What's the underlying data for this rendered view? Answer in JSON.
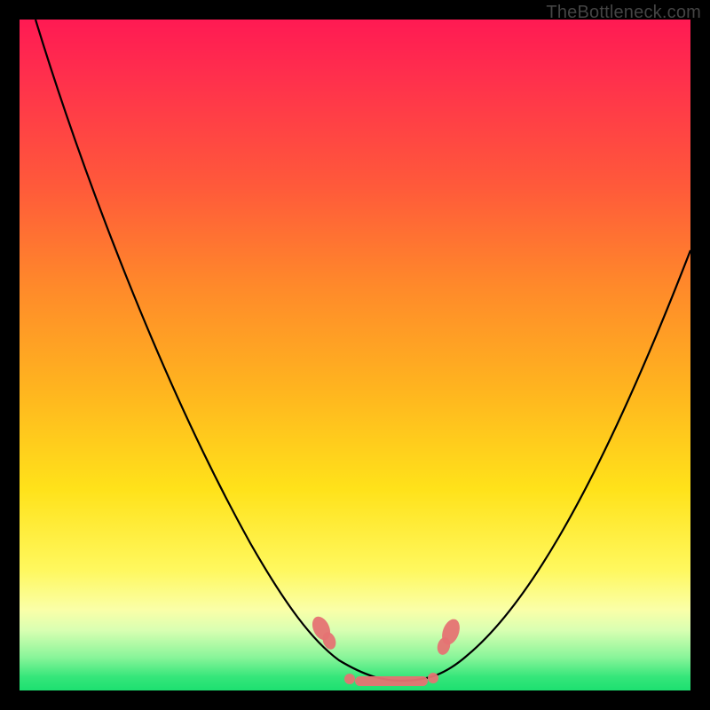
{
  "watermark": "TheBottleneck.com",
  "colors": {
    "background": "#000000",
    "gradient_top": "#ff1a53",
    "gradient_mid": "#ffe21a",
    "gradient_bottom": "#1de070",
    "curve": "#000000",
    "marker": "#e57373"
  },
  "chart_data": {
    "type": "line",
    "title": "",
    "xlabel": "",
    "ylabel": "",
    "xlim": [
      0,
      100
    ],
    "ylim": [
      0,
      100
    ],
    "grid": false,
    "legend": false,
    "series": [
      {
        "name": "bottleneck-curve",
        "x": [
          2,
          5,
          10,
          15,
          20,
          25,
          30,
          35,
          40,
          45,
          48,
          50,
          52,
          55,
          58,
          60,
          63,
          66,
          70,
          75,
          80,
          85,
          90,
          95,
          100
        ],
        "y": [
          100,
          94,
          83,
          73,
          63,
          53,
          44,
          35,
          26,
          17,
          11,
          7,
          4,
          2,
          1,
          1,
          2,
          4,
          8,
          15,
          24,
          34,
          45,
          56,
          67
        ]
      }
    ],
    "annotations": [
      {
        "name": "marker-left-blob",
        "x": 47,
        "y": 10
      },
      {
        "name": "marker-right-blob",
        "x": 64,
        "y": 8
      },
      {
        "name": "marker-flat-bottom",
        "x": 56,
        "y": 1.5
      }
    ]
  }
}
